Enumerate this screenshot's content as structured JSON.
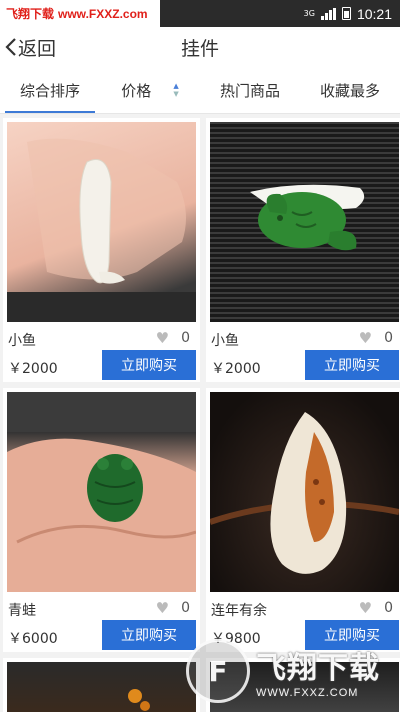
{
  "status_bar": {
    "watermark": {
      "brand": "飞翔下载",
      "url": "www.FXXZ.com"
    },
    "network": "3G",
    "time": "10:21"
  },
  "nav": {
    "back_label": "返回",
    "title": "挂件"
  },
  "filters": [
    {
      "label": "综合排序",
      "active": true
    },
    {
      "label": "价格",
      "active": false
    },
    {
      "label": "热门商品",
      "active": false
    },
    {
      "label": "收藏最多",
      "active": false
    }
  ],
  "products": [
    {
      "name": "小鱼",
      "likes": "0",
      "price": "￥2000",
      "buy_label": "立即购买"
    },
    {
      "name": "小鱼",
      "likes": "0",
      "price": "￥2000",
      "buy_label": "立即购买"
    },
    {
      "name": "青蛙",
      "likes": "0",
      "price": "￥6000",
      "buy_label": "立即购买"
    },
    {
      "name": "连年有余",
      "likes": "0",
      "price": "￥9800",
      "buy_label": "立即购买"
    }
  ],
  "bottom_watermark": {
    "brand": "飞翔下载",
    "url": "WWW.FXXZ.COM"
  },
  "colors": {
    "accent": "#2a6fd6",
    "tab_underline": "#3d7ad6",
    "status_bar": "#2b2b2b"
  }
}
